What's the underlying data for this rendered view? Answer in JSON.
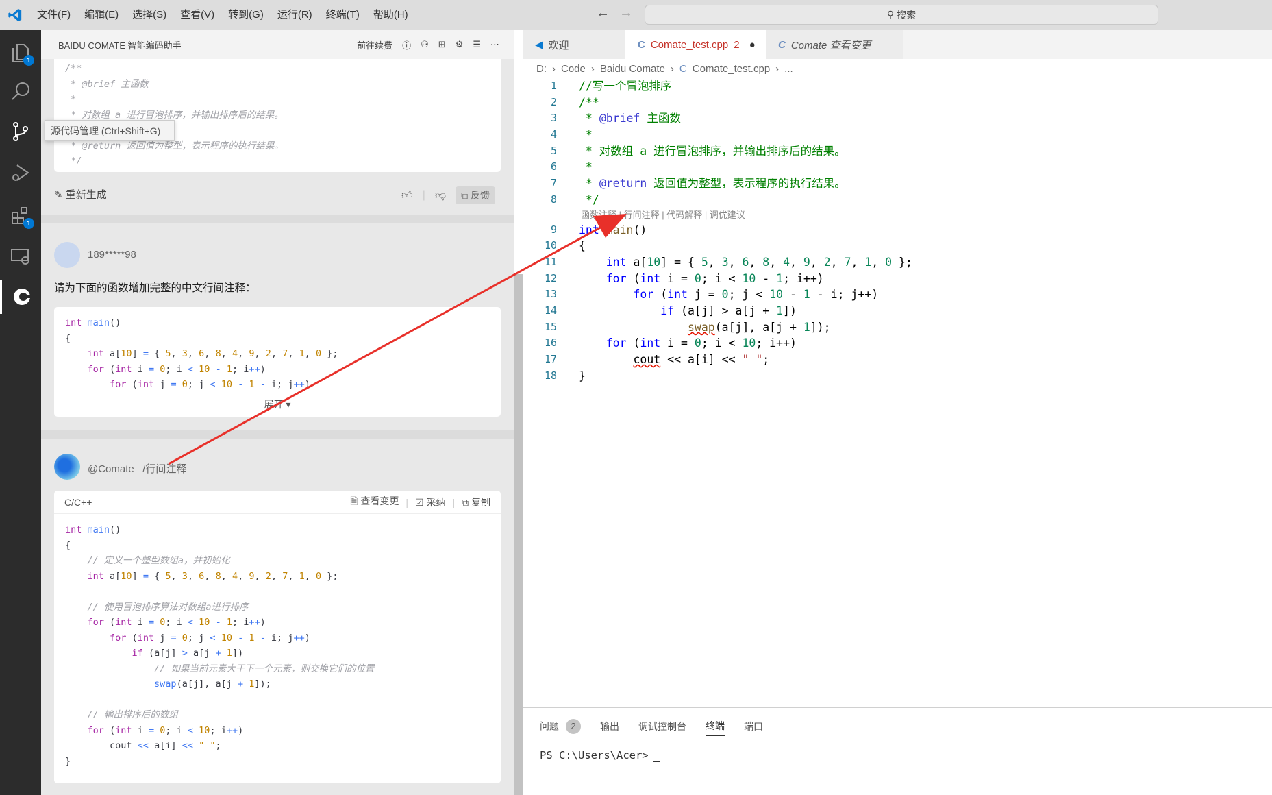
{
  "titlebar": {
    "menu": [
      "文件(F)",
      "编辑(E)",
      "选择(S)",
      "查看(V)",
      "转到(G)",
      "运行(R)",
      "终端(T)",
      "帮助(H)"
    ],
    "search": "搜索"
  },
  "activity": {
    "explorer_badge": "1",
    "extensions_badge": "1",
    "tooltip": "源代码管理 (Ctrl+Shift+G)"
  },
  "side": {
    "title": "BAIDU COMATE 智能编码助手",
    "renew": "前往续费",
    "card1_lines": [
      [
        [
          "c",
          "/**"
        ]
      ],
      [
        [
          "c",
          " * @brief 主函数"
        ]
      ],
      [
        [
          "c",
          " *"
        ]
      ],
      [
        [
          "c",
          " * 对数组 a 进行冒泡排序，并输出排序后的结果。"
        ]
      ],
      [
        [
          "c",
          " *"
        ]
      ],
      [
        [
          "c",
          " * @return 返回值为整型，表示程序的执行结果。"
        ]
      ],
      [
        [
          "c",
          " */"
        ]
      ]
    ],
    "regenerate": "重新生成",
    "feedback": "反馈",
    "user": "189*****98",
    "prompt": "请为下面的函数增加完整的中文行间注释：",
    "card2_lines": [
      [
        [
          "k",
          "int"
        ],
        [
          "p",
          " "
        ],
        [
          "f",
          "main"
        ],
        [
          "p",
          "()"
        ]
      ],
      [
        [
          "p",
          "{"
        ]
      ],
      [
        [
          "p",
          "    "
        ],
        [
          "k",
          "int"
        ],
        [
          "p",
          " a["
        ],
        [
          "n",
          "10"
        ],
        [
          "p",
          "] "
        ],
        [
          "o",
          "="
        ],
        [
          "p",
          " { "
        ],
        [
          "n",
          "5"
        ],
        [
          "p",
          ", "
        ],
        [
          "n",
          "3"
        ],
        [
          "p",
          ", "
        ],
        [
          "n",
          "6"
        ],
        [
          "p",
          ", "
        ],
        [
          "n",
          "8"
        ],
        [
          "p",
          ", "
        ],
        [
          "n",
          "4"
        ],
        [
          "p",
          ", "
        ],
        [
          "n",
          "9"
        ],
        [
          "p",
          ", "
        ],
        [
          "n",
          "2"
        ],
        [
          "p",
          ", "
        ],
        [
          "n",
          "7"
        ],
        [
          "p",
          ", "
        ],
        [
          "n",
          "1"
        ],
        [
          "p",
          ", "
        ],
        [
          "n",
          "0"
        ],
        [
          "p",
          " };"
        ]
      ],
      [
        [
          "p",
          "    "
        ],
        [
          "k",
          "for"
        ],
        [
          "p",
          " ("
        ],
        [
          "k",
          "int"
        ],
        [
          "p",
          " i "
        ],
        [
          "o",
          "="
        ],
        [
          "p",
          " "
        ],
        [
          "n",
          "0"
        ],
        [
          "p",
          "; i "
        ],
        [
          "o",
          "<"
        ],
        [
          "p",
          " "
        ],
        [
          "n",
          "10"
        ],
        [
          "p",
          " "
        ],
        [
          "o",
          "-"
        ],
        [
          "p",
          " "
        ],
        [
          "n",
          "1"
        ],
        [
          "p",
          "; i"
        ],
        [
          "o",
          "++"
        ],
        [
          "p",
          ")"
        ]
      ],
      [
        [
          "p",
          "        "
        ],
        [
          "k",
          "for"
        ],
        [
          "p",
          " ("
        ],
        [
          "k",
          "int"
        ],
        [
          "p",
          " j "
        ],
        [
          "o",
          "="
        ],
        [
          "p",
          " "
        ],
        [
          "n",
          "0"
        ],
        [
          "p",
          "; j "
        ],
        [
          "o",
          "<"
        ],
        [
          "p",
          " "
        ],
        [
          "n",
          "10"
        ],
        [
          "p",
          " "
        ],
        [
          "o",
          "-"
        ],
        [
          "p",
          " "
        ],
        [
          "n",
          "1"
        ],
        [
          "p",
          " "
        ],
        [
          "o",
          "-"
        ],
        [
          "p",
          " i; j"
        ],
        [
          "o",
          "++"
        ],
        [
          "p",
          ")"
        ]
      ]
    ],
    "expand": "展开",
    "bot": "@Comate",
    "command": "/行间注释",
    "lang": "C/C++",
    "view_changes": "查看变更",
    "accept": "采纳",
    "copy": "复制",
    "card3_lines": [
      [
        [
          "k",
          "int"
        ],
        [
          "p",
          " "
        ],
        [
          "f",
          "main"
        ],
        [
          "p",
          "()"
        ]
      ],
      [
        [
          "p",
          "{"
        ]
      ],
      [
        [
          "p",
          "    "
        ],
        [
          "c",
          "// 定义一个整型数组a，并初始化"
        ]
      ],
      [
        [
          "p",
          "    "
        ],
        [
          "k",
          "int"
        ],
        [
          "p",
          " a["
        ],
        [
          "n",
          "10"
        ],
        [
          "p",
          "] "
        ],
        [
          "o",
          "="
        ],
        [
          "p",
          " { "
        ],
        [
          "n",
          "5"
        ],
        [
          "p",
          ", "
        ],
        [
          "n",
          "3"
        ],
        [
          "p",
          ", "
        ],
        [
          "n",
          "6"
        ],
        [
          "p",
          ", "
        ],
        [
          "n",
          "8"
        ],
        [
          "p",
          ", "
        ],
        [
          "n",
          "4"
        ],
        [
          "p",
          ", "
        ],
        [
          "n",
          "9"
        ],
        [
          "p",
          ", "
        ],
        [
          "n",
          "2"
        ],
        [
          "p",
          ", "
        ],
        [
          "n",
          "7"
        ],
        [
          "p",
          ", "
        ],
        [
          "n",
          "1"
        ],
        [
          "p",
          ", "
        ],
        [
          "n",
          "0"
        ],
        [
          "p",
          " };"
        ]
      ],
      [
        [
          "p",
          " "
        ]
      ],
      [
        [
          "p",
          "    "
        ],
        [
          "c",
          "// 使用冒泡排序算法对数组a进行排序"
        ]
      ],
      [
        [
          "p",
          "    "
        ],
        [
          "k",
          "for"
        ],
        [
          "p",
          " ("
        ],
        [
          "k",
          "int"
        ],
        [
          "p",
          " i "
        ],
        [
          "o",
          "="
        ],
        [
          "p",
          " "
        ],
        [
          "n",
          "0"
        ],
        [
          "p",
          "; i "
        ],
        [
          "o",
          "<"
        ],
        [
          "p",
          " "
        ],
        [
          "n",
          "10"
        ],
        [
          "p",
          " "
        ],
        [
          "o",
          "-"
        ],
        [
          "p",
          " "
        ],
        [
          "n",
          "1"
        ],
        [
          "p",
          "; i"
        ],
        [
          "o",
          "++"
        ],
        [
          "p",
          ")"
        ]
      ],
      [
        [
          "p",
          "        "
        ],
        [
          "k",
          "for"
        ],
        [
          "p",
          " ("
        ],
        [
          "k",
          "int"
        ],
        [
          "p",
          " j "
        ],
        [
          "o",
          "="
        ],
        [
          "p",
          " "
        ],
        [
          "n",
          "0"
        ],
        [
          "p",
          "; j "
        ],
        [
          "o",
          "<"
        ],
        [
          "p",
          " "
        ],
        [
          "n",
          "10"
        ],
        [
          "p",
          " "
        ],
        [
          "o",
          "-"
        ],
        [
          "p",
          " "
        ],
        [
          "n",
          "1"
        ],
        [
          "p",
          " "
        ],
        [
          "o",
          "-"
        ],
        [
          "p",
          " i; j"
        ],
        [
          "o",
          "++"
        ],
        [
          "p",
          ")"
        ]
      ],
      [
        [
          "p",
          "            "
        ],
        [
          "k",
          "if"
        ],
        [
          "p",
          " (a[j] "
        ],
        [
          "o",
          ">"
        ],
        [
          "p",
          " a[j "
        ],
        [
          "o",
          "+"
        ],
        [
          "p",
          " "
        ],
        [
          "n",
          "1"
        ],
        [
          "p",
          "])"
        ]
      ],
      [
        [
          "p",
          "                "
        ],
        [
          "c",
          "// 如果当前元素大于下一个元素，则交换它们的位置"
        ]
      ],
      [
        [
          "p",
          "                "
        ],
        [
          "f",
          "swap"
        ],
        [
          "p",
          "(a[j], a[j "
        ],
        [
          "o",
          "+"
        ],
        [
          "p",
          " "
        ],
        [
          "n",
          "1"
        ],
        [
          "p",
          "]);"
        ]
      ],
      [
        [
          "p",
          " "
        ]
      ],
      [
        [
          "p",
          "    "
        ],
        [
          "c",
          "// 输出排序后的数组"
        ]
      ],
      [
        [
          "p",
          "    "
        ],
        [
          "k",
          "for"
        ],
        [
          "p",
          " ("
        ],
        [
          "k",
          "int"
        ],
        [
          "p",
          " i "
        ],
        [
          "o",
          "="
        ],
        [
          "p",
          " "
        ],
        [
          "n",
          "0"
        ],
        [
          "p",
          "; i "
        ],
        [
          "o",
          "<"
        ],
        [
          "p",
          " "
        ],
        [
          "n",
          "10"
        ],
        [
          "p",
          "; i"
        ],
        [
          "o",
          "++"
        ],
        [
          "p",
          ")"
        ]
      ],
      [
        [
          "p",
          "        cout "
        ],
        [
          "o",
          "<<"
        ],
        [
          "p",
          " a[i] "
        ],
        [
          "o",
          "<<"
        ],
        [
          "p",
          " "
        ],
        [
          "n",
          "\" \""
        ],
        [
          "p",
          ";"
        ]
      ],
      [
        [
          "p",
          "}"
        ]
      ]
    ]
  },
  "editor": {
    "tabs": [
      {
        "label": "欢迎"
      },
      {
        "label": "Comate_test.cpp",
        "problems": "2"
      },
      {
        "label": "Comate 查看变更"
      }
    ],
    "breadcrumb": [
      "D:",
      "Code",
      "Baidu Comate",
      "Comate_test.cpp",
      "..."
    ],
    "lines": [
      [
        [
          "ec",
          "//写一个冒泡排序"
        ]
      ],
      [
        [
          "ec",
          "/**"
        ]
      ],
      [
        [
          "ec",
          " * "
        ],
        [
          "et",
          "@brief"
        ],
        [
          "ec",
          " 主函数"
        ]
      ],
      [
        [
          "ec",
          " *"
        ]
      ],
      [
        [
          "ec",
          " * 对数组 a 进行冒泡排序，并输出排序后的结果。"
        ]
      ],
      [
        [
          "ec",
          " *"
        ]
      ],
      [
        [
          "ec",
          " * "
        ],
        [
          "et",
          "@return"
        ],
        [
          "ec",
          " 返回值为整型，表示程序的执行结果。"
        ]
      ],
      [
        [
          "ec",
          " */"
        ]
      ],
      [
        [
          "ek",
          "int"
        ],
        [
          "ep",
          " "
        ],
        [
          "ef",
          "main"
        ],
        [
          "ep",
          "()"
        ]
      ],
      [
        [
          "ep",
          "{"
        ]
      ],
      [
        [
          "ep",
          "    "
        ],
        [
          "ek",
          "int"
        ],
        [
          "ep",
          " a["
        ],
        [
          "en",
          "10"
        ],
        [
          "ep",
          "] = { "
        ],
        [
          "en",
          "5"
        ],
        [
          "ep",
          ", "
        ],
        [
          "en",
          "3"
        ],
        [
          "ep",
          ", "
        ],
        [
          "en",
          "6"
        ],
        [
          "ep",
          ", "
        ],
        [
          "en",
          "8"
        ],
        [
          "ep",
          ", "
        ],
        [
          "en",
          "4"
        ],
        [
          "ep",
          ", "
        ],
        [
          "en",
          "9"
        ],
        [
          "ep",
          ", "
        ],
        [
          "en",
          "2"
        ],
        [
          "ep",
          ", "
        ],
        [
          "en",
          "7"
        ],
        [
          "ep",
          ", "
        ],
        [
          "en",
          "1"
        ],
        [
          "ep",
          ", "
        ],
        [
          "en",
          "0"
        ],
        [
          "ep",
          " };"
        ]
      ],
      [
        [
          "ep",
          "    "
        ],
        [
          "ek",
          "for"
        ],
        [
          "ep",
          " ("
        ],
        [
          "ek",
          "int"
        ],
        [
          "ep",
          " i = "
        ],
        [
          "en",
          "0"
        ],
        [
          "ep",
          "; i < "
        ],
        [
          "en",
          "10"
        ],
        [
          "ep",
          " - "
        ],
        [
          "en",
          "1"
        ],
        [
          "ep",
          "; i++)"
        ]
      ],
      [
        [
          "ep",
          "        "
        ],
        [
          "ek",
          "for"
        ],
        [
          "ep",
          " ("
        ],
        [
          "ek",
          "int"
        ],
        [
          "ep",
          " j = "
        ],
        [
          "en",
          "0"
        ],
        [
          "ep",
          "; j < "
        ],
        [
          "en",
          "10"
        ],
        [
          "ep",
          " - "
        ],
        [
          "en",
          "1"
        ],
        [
          "ep",
          " - i; j++)"
        ]
      ],
      [
        [
          "ep",
          "            "
        ],
        [
          "ek",
          "if"
        ],
        [
          "ep",
          " (a[j] > a[j + "
        ],
        [
          "en",
          "1"
        ],
        [
          "ep",
          "])"
        ]
      ],
      [
        [
          "ep",
          "                "
        ],
        [
          "ef sq",
          "swap"
        ],
        [
          "ep",
          "(a[j], a[j + "
        ],
        [
          "en",
          "1"
        ],
        [
          "ep",
          "]);"
        ]
      ],
      [
        [
          "ep",
          "    "
        ],
        [
          "ek",
          "for"
        ],
        [
          "ep",
          " ("
        ],
        [
          "ek",
          "int"
        ],
        [
          "ep",
          " i = "
        ],
        [
          "en",
          "0"
        ],
        [
          "ep",
          "; i < "
        ],
        [
          "en",
          "10"
        ],
        [
          "ep",
          "; i++)"
        ]
      ],
      [
        [
          "ep",
          "        "
        ],
        [
          "ep sq",
          "cout"
        ],
        [
          "ep",
          " << a[i] << "
        ],
        [
          "es",
          "\" \""
        ],
        [
          "ep",
          ";"
        ]
      ],
      [
        [
          "ep",
          "}"
        ]
      ]
    ],
    "codelens": "函数注释 | 行间注释 | 代码解释 | 调优建议"
  },
  "panel": {
    "tabs": [
      "问题",
      "输出",
      "调试控制台",
      "终端",
      "端口"
    ],
    "problems_count": "2",
    "active_tab": "终端",
    "prompt": "PS C:\\Users\\Acer>"
  },
  "colors": {
    "annotation_arrow": "#e8302a",
    "activity_bg": "#2c2c2c",
    "accent": "#0078d4"
  }
}
